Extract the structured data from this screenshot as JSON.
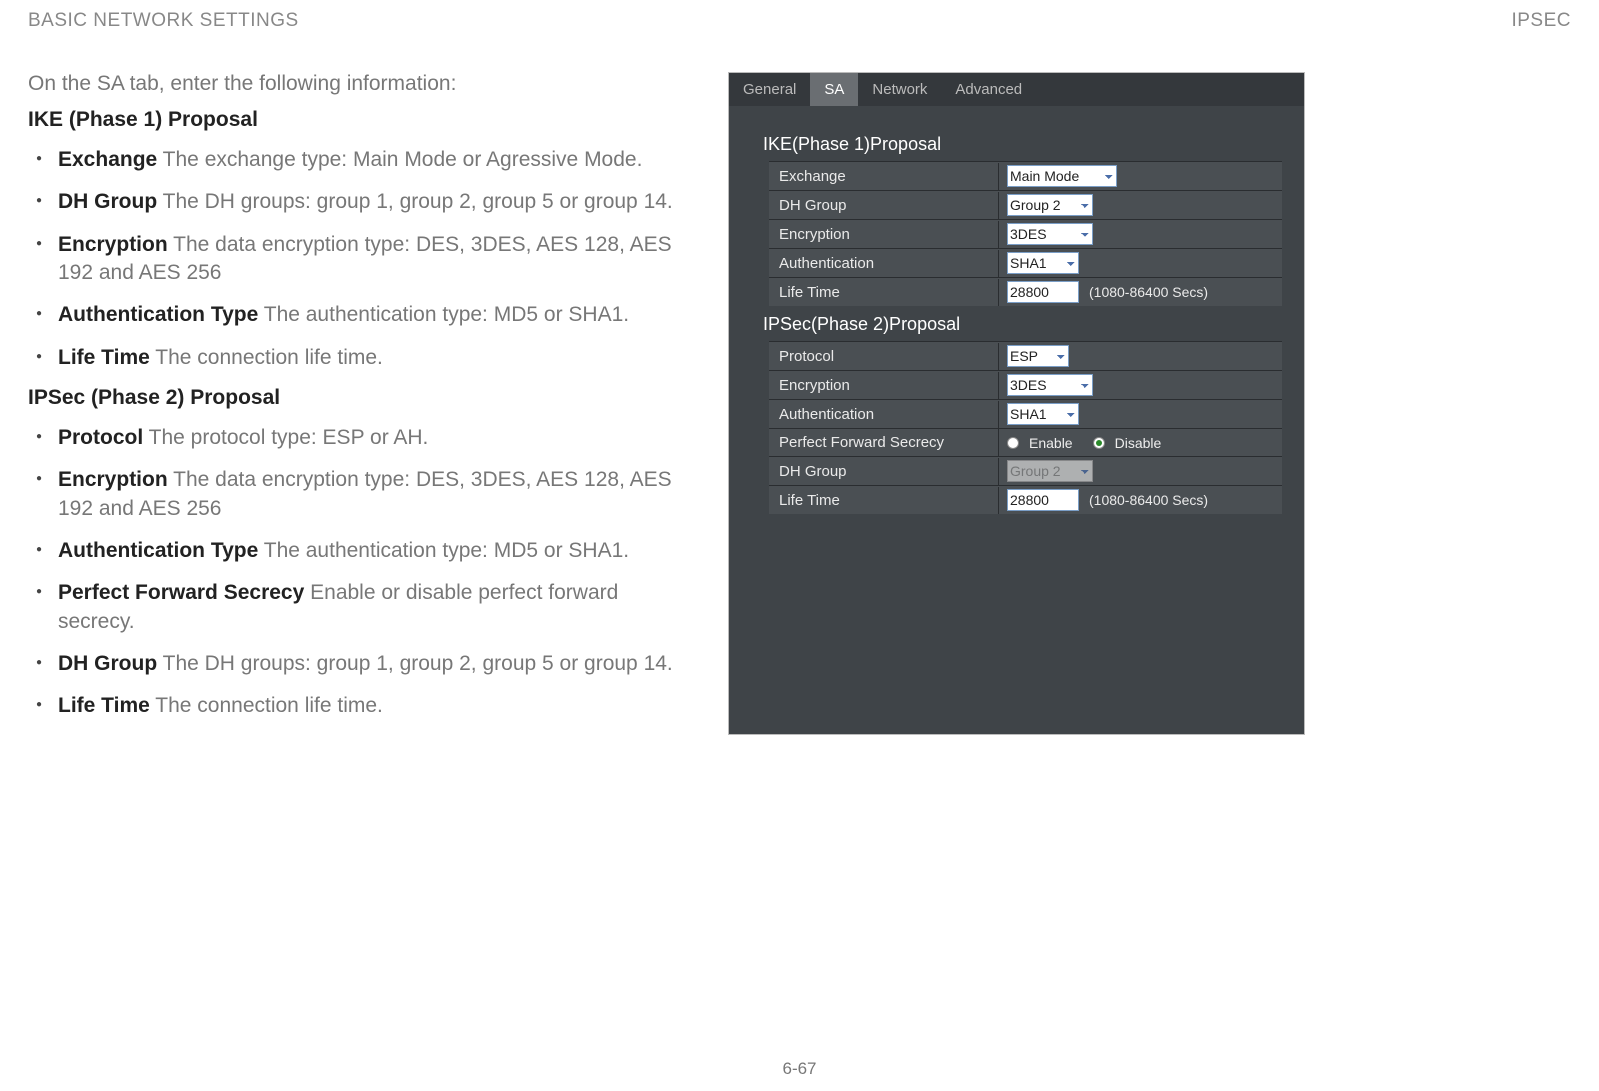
{
  "header": {
    "left": "BASIC NETWORK SETTINGS",
    "right": "IPSEC"
  },
  "intro": "On the SA tab, enter the following information:",
  "sections": [
    {
      "title": "IKE (Phase 1) Proposal",
      "items": [
        {
          "term": "Exchange",
          "desc": " The exchange type: Main Mode or Agressive Mode."
        },
        {
          "term": "DH Group",
          "desc": " The DH groups: group 1, group 2, group 5 or group 14."
        },
        {
          "term": "Encryption",
          "desc": "  The data encryption type: DES, 3DES, AES 128, AES 192 and AES 256"
        },
        {
          "term": "Authentication Type",
          "desc": "  The authentication type: MD5 or SHA1."
        },
        {
          "term": "Life Time",
          "desc": "  The connection life time."
        }
      ]
    },
    {
      "title": "IPSec (Phase 2) Proposal",
      "items": [
        {
          "term": "Protocol",
          "desc": "  The protocol type: ESP or AH."
        },
        {
          "term": "Encryption",
          "desc": "  The data encryption type: DES, 3DES, AES 128, AES 192 and AES 256"
        },
        {
          "term": "Authentication Type",
          "desc": "  The authentication type: MD5 or SHA1."
        },
        {
          "term": "Perfect Forward Secrecy",
          "desc": "  Enable or disable perfect forward secrecy."
        },
        {
          "term": "DH Group",
          "desc": " The DH groups: group 1, group 2, group 5 or group 14."
        },
        {
          "term": "Life Time",
          "desc": "  The connection life time."
        }
      ]
    }
  ],
  "footer": "6-67",
  "panel": {
    "tabs": [
      "General",
      "SA",
      "Network",
      "Advanced"
    ],
    "activeTab": 1,
    "phase1": {
      "title": "IKE(Phase 1)Proposal",
      "rows": {
        "exchange": {
          "label": "Exchange",
          "value": "Main Mode"
        },
        "dhgroup": {
          "label": "DH Group",
          "value": "Group 2"
        },
        "encryption": {
          "label": "Encryption",
          "value": "3DES"
        },
        "auth": {
          "label": "Authentication",
          "value": "SHA1"
        },
        "lifetime": {
          "label": "Life Time",
          "value": "28800",
          "hint": "(1080-86400 Secs)"
        }
      }
    },
    "phase2": {
      "title": "IPSec(Phase 2)Proposal",
      "rows": {
        "protocol": {
          "label": "Protocol",
          "value": "ESP"
        },
        "encryption": {
          "label": "Encryption",
          "value": "3DES"
        },
        "auth": {
          "label": "Authentication",
          "value": "SHA1"
        },
        "pfs": {
          "label": "Perfect Forward Secrecy",
          "enable": "Enable",
          "disable": "Disable",
          "selected": "disable"
        },
        "dhgroup": {
          "label": "DH Group",
          "value": "Group 2",
          "disabled": true
        },
        "lifetime": {
          "label": "Life Time",
          "value": "28800",
          "hint": "(1080-86400 Secs)"
        }
      }
    }
  }
}
